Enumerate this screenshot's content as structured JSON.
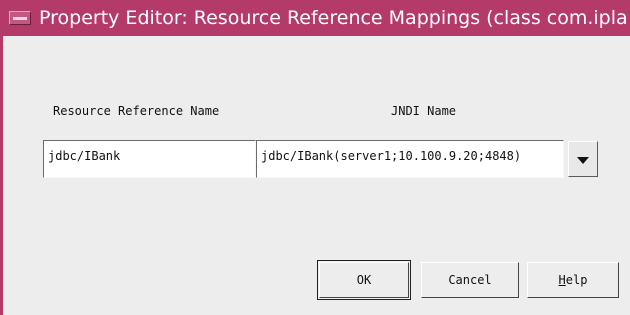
{
  "window": {
    "title": "Property Editor: Resource Reference Mappings (class com.ipla",
    "accent_color": "#b43a6a",
    "menu_icon": "window-menu-icon"
  },
  "labels": {
    "resource_ref_name": "Resource Reference Name",
    "jndi_name": "JNDI Name"
  },
  "mapping": {
    "resource_ref_value": "jdbc/IBank",
    "jndi_value": "jdbc/IBank(server1;10.100.9.20;4848)",
    "dropdown_icon": "chevron-down-icon"
  },
  "buttons": {
    "ok": "OK",
    "cancel": "Cancel",
    "help_mnemonic": "H",
    "help_rest": "elp"
  }
}
